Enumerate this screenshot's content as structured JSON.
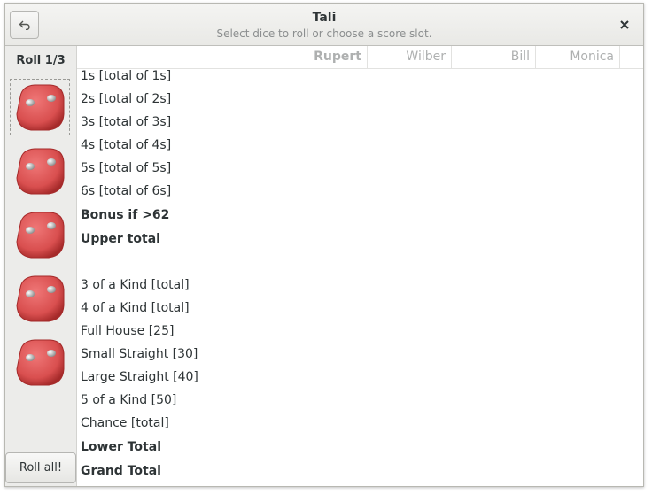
{
  "window": {
    "title": "Tali",
    "subtitle": "Select dice to roll or choose a score slot."
  },
  "sidebar": {
    "roll_label": "Roll 1/3",
    "roll_all_label": "Roll all!",
    "dice": [
      {
        "face": 2,
        "selected": true
      },
      {
        "face": 2,
        "selected": false
      },
      {
        "face": 2,
        "selected": false
      },
      {
        "face": 2,
        "selected": false
      },
      {
        "face": 2,
        "selected": false
      }
    ]
  },
  "players": [
    "Rupert",
    "Wilber",
    "Bill",
    "Monica"
  ],
  "active_player": "Rupert",
  "rows": [
    {
      "label": "1s [total of 1s]",
      "bold": false
    },
    {
      "label": "2s [total of 2s]",
      "bold": false
    },
    {
      "label": "3s [total of 3s]",
      "bold": false
    },
    {
      "label": "4s [total of 4s]",
      "bold": false
    },
    {
      "label": "5s [total of 5s]",
      "bold": false
    },
    {
      "label": "6s [total of 6s]",
      "bold": false
    },
    {
      "label": "Bonus if >62",
      "bold": true
    },
    {
      "label": "Upper total",
      "bold": true
    },
    {
      "label": "",
      "bold": false
    },
    {
      "label": "3 of a Kind [total]",
      "bold": false
    },
    {
      "label": "4 of a Kind [total]",
      "bold": false
    },
    {
      "label": "Full House [25]",
      "bold": false
    },
    {
      "label": "Small Straight [30]",
      "bold": false
    },
    {
      "label": "Large Straight [40]",
      "bold": false
    },
    {
      "label": "5 of a Kind [50]",
      "bold": false
    },
    {
      "label": "Chance [total]",
      "bold": false
    },
    {
      "label": "Lower Total",
      "bold": true
    },
    {
      "label": "Grand Total",
      "bold": true
    }
  ],
  "colors": {
    "die": "#d94f4f",
    "die_dark": "#a52a2a",
    "header_text": "#aeb0b0"
  },
  "icons": {
    "back": "undo-arrow-icon",
    "close": "close-icon",
    "die": "die-icon"
  }
}
